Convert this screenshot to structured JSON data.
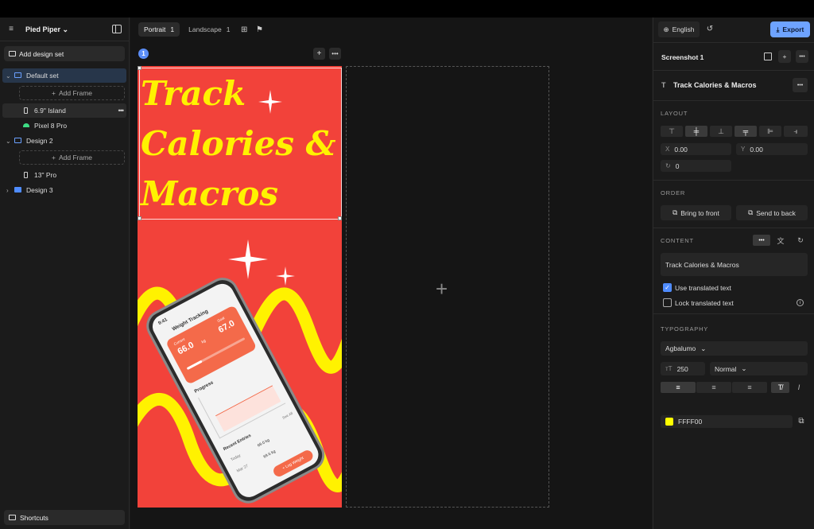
{
  "project": {
    "name": "Pied Piper"
  },
  "sidebar": {
    "add_design_set": "Add design set",
    "shortcuts": "Shortcuts",
    "add_frame": "Add Frame",
    "sets": [
      {
        "name": "Default set",
        "devices": [
          "6.9\" Island",
          "Pixel 8 Pro"
        ]
      },
      {
        "name": "Design 2",
        "devices": [
          "13\" Pro"
        ]
      },
      {
        "name": "Design 3"
      }
    ]
  },
  "canvas": {
    "tabs": [
      {
        "label": "Portrait",
        "count": "1"
      },
      {
        "label": "Landscape",
        "count": "1"
      }
    ],
    "screen_number": "1",
    "heading": "Track\nCalories &\nMacros"
  },
  "phone_mock": {
    "time": "9:41",
    "title": "Weight Tracking",
    "current_label": "Current",
    "current_value": "66.0",
    "goal_label": "Goal",
    "goal_value": "67.0",
    "unit": "kg",
    "progress_title": "Progress",
    "recent_title": "Recent Entries",
    "entry1_day": "Today",
    "entry1_value": "69.0 kg",
    "entry2_day": "Mar 27",
    "entry2_value": "69.6 kg",
    "log_button": "+ Log Weight",
    "see_all": "See All"
  },
  "right_panel": {
    "language": "English",
    "export": "Export",
    "screenshot_title": "Screenshot 1",
    "element_title": "Track Calories & Macros",
    "layout": {
      "label": "LAYOUT",
      "x_label": "X",
      "x": "0.00",
      "y_label": "Y",
      "y": "0.00",
      "rotation": "0"
    },
    "order": {
      "label": "ORDER",
      "bring_front": "Bring to front",
      "send_back": "Send to back"
    },
    "content": {
      "label": "CONTENT",
      "text": "Track Calories & Macros",
      "use_translated": "Use translated text",
      "lock_translated": "Lock translated text"
    },
    "typography": {
      "label": "TYPOGRAPHY",
      "font": "Agbalumo",
      "size": "250",
      "weight": "Normal",
      "color_hex": "FFFF00",
      "color": "#ffff00"
    }
  }
}
